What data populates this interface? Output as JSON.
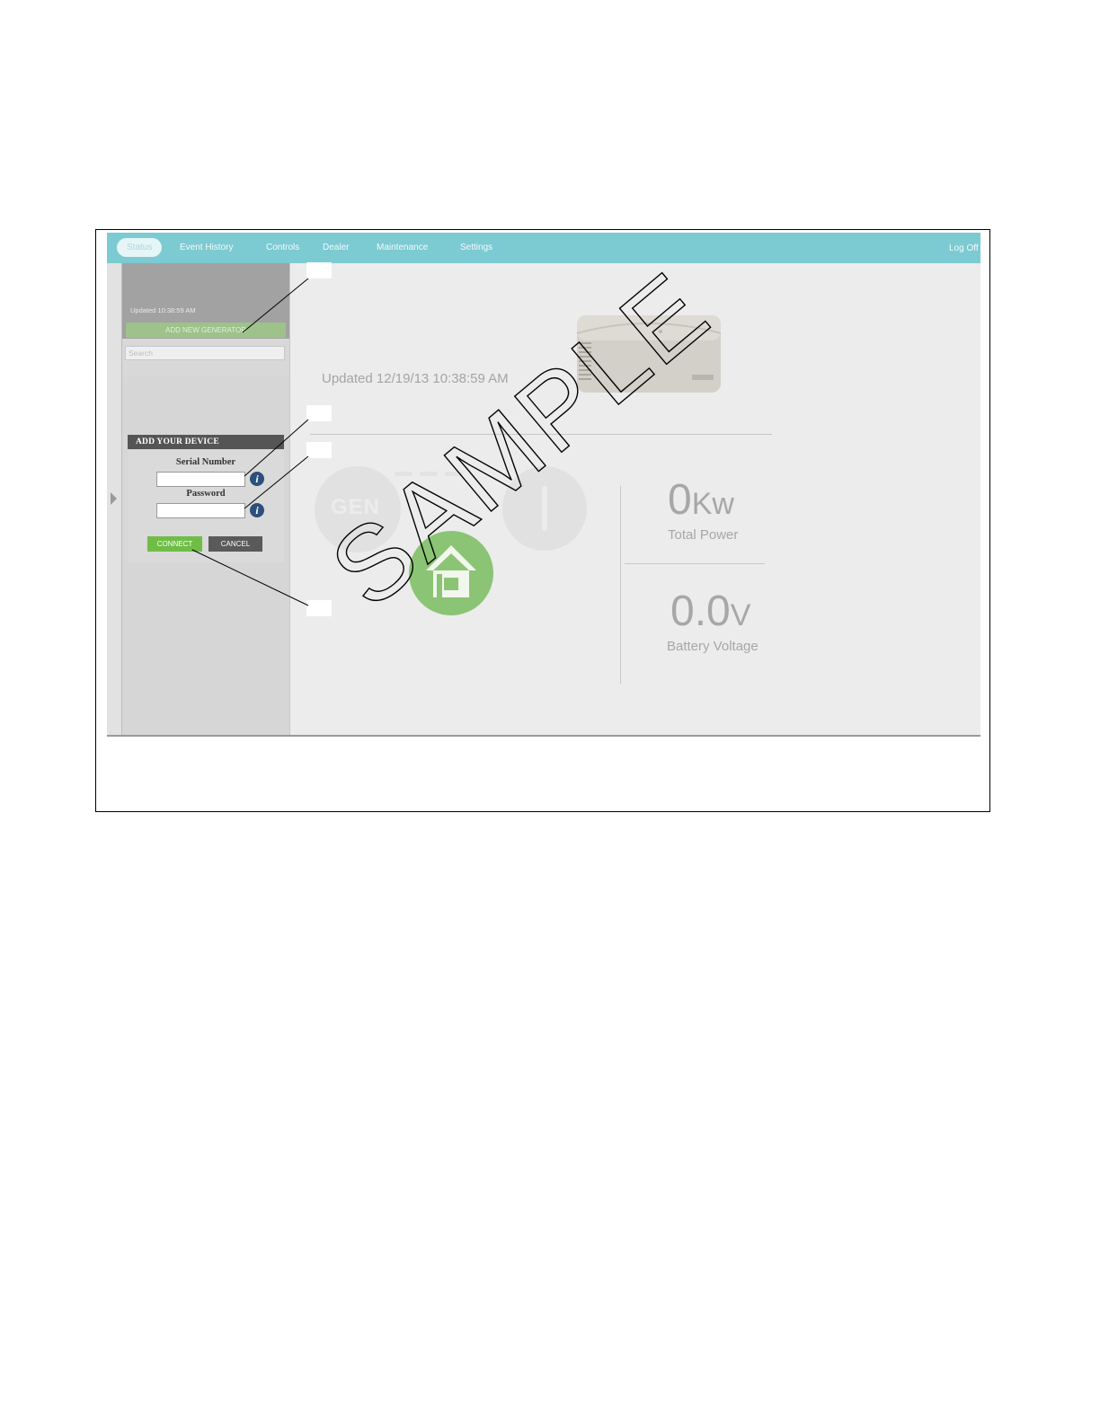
{
  "nav": {
    "items": [
      "Status",
      "Event History",
      "Controls",
      "Dealer",
      "Maintenance",
      "Settings"
    ],
    "active": "Status",
    "logoff": "Log Off"
  },
  "sidebar": {
    "generator_updated": "Updated 10:38:59 AM",
    "add_generator_label": "ADD NEW GENERATOR",
    "search_placeholder": "Search"
  },
  "device_form": {
    "title": "ADD YOUR DEVICE",
    "serial_label": "Serial Number",
    "password_label": "Password",
    "serial_value": "",
    "password_value": "",
    "connect_label": "CONNECT",
    "cancel_label": "CANCEL"
  },
  "status": {
    "updated": "Updated 12/19/13 10:38:59 AM",
    "gen_label": "GEN",
    "total_power_value": "0",
    "total_power_unit": "Kw",
    "total_power_label": "Total Power",
    "battery_value": "0.0",
    "battery_unit": "V",
    "battery_label": "Battery Voltage"
  },
  "watermark": "SAMPLE",
  "colors": {
    "topbar": "#7ccad2",
    "connect": "#6fbd45",
    "cancel": "#5a5a5a",
    "home": "#8bc474",
    "info": "#2c4f7c"
  }
}
